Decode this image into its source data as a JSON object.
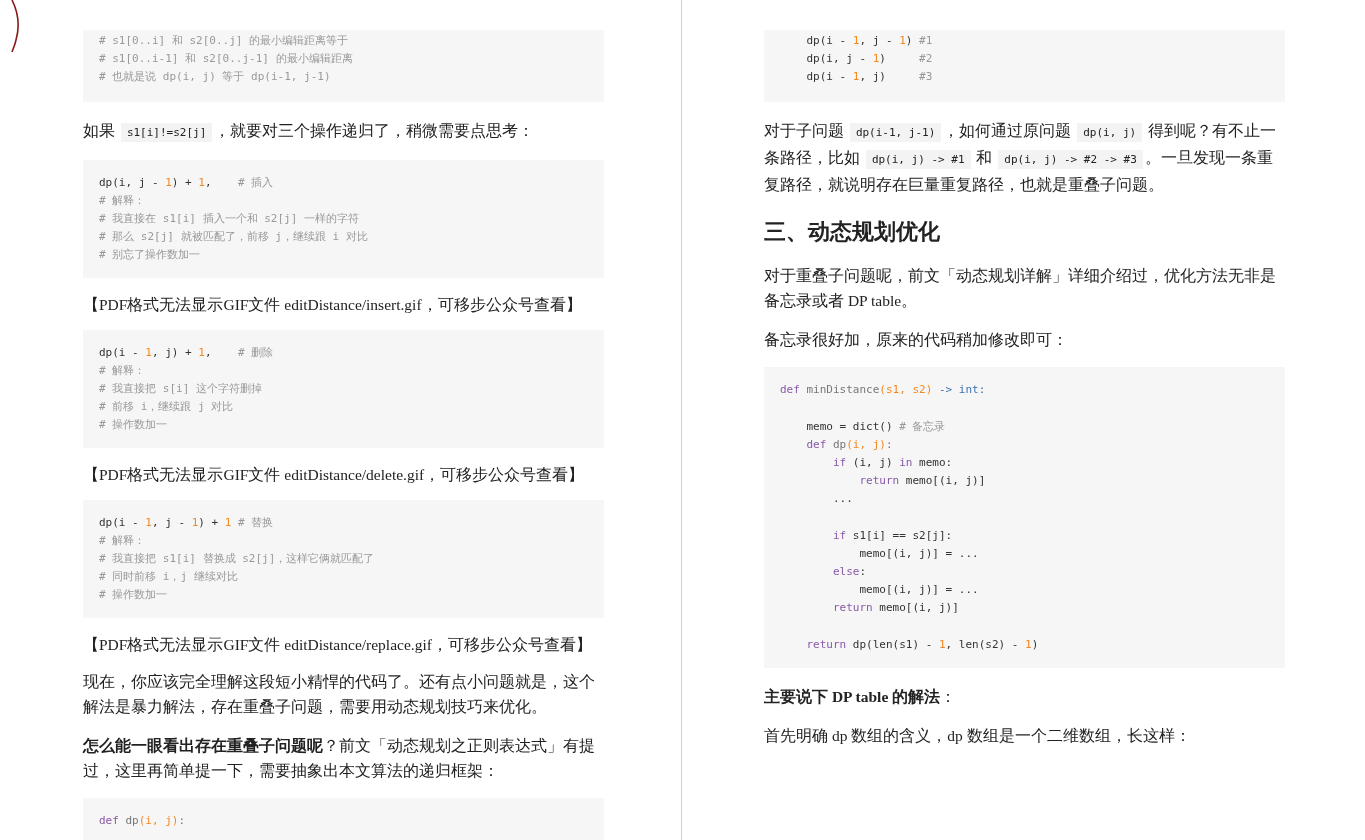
{
  "pages": [
    {
      "blocks": [
        {
          "kind": "code",
          "cut_top": true,
          "lines": [
            {
              "tokens": [
                {
                  "kind": "comment",
                  "text": "# s1[0..i] 和 s2[0..j] 的最小编辑距离等于"
                }
              ]
            },
            {
              "tokens": [
                {
                  "kind": "comment",
                  "text": "# s1[0..i-1] 和 s2[0..j-1] 的最小编辑距离"
                }
              ]
            },
            {
              "tokens": [
                {
                  "kind": "comment",
                  "text": "# 也就是说 dp(i, j) 等于 dp(i-1, j-1)"
                }
              ]
            }
          ]
        },
        {
          "kind": "paragraph",
          "segments": [
            {
              "kind": "text",
              "text": "如果 "
            },
            {
              "kind": "code",
              "text": "s1[i]!=s2[j]"
            },
            {
              "kind": "text",
              "text": "，就要对三个操作递归了，稍微需要点思考："
            }
          ]
        },
        {
          "kind": "code",
          "cut_top": false,
          "lines": [
            {
              "tokens": [
                {
                  "kind": "plain",
                  "text": "dp(i, j - "
                },
                {
                  "kind": "number",
                  "text": "1"
                },
                {
                  "kind": "plain",
                  "text": ") + "
                },
                {
                  "kind": "number",
                  "text": "1"
                },
                {
                  "kind": "plain",
                  "text": ",    "
                },
                {
                  "kind": "comment",
                  "text": "# 插入"
                }
              ]
            },
            {
              "tokens": [
                {
                  "kind": "comment",
                  "text": "# 解释："
                }
              ]
            },
            {
              "tokens": [
                {
                  "kind": "comment",
                  "text": "# 我直接在 s1[i] 插入一个和 s2[j] 一样的字符"
                }
              ]
            },
            {
              "tokens": [
                {
                  "kind": "comment",
                  "text": "# 那么 s2[j] 就被匹配了，前移 j，继续跟 i 对比"
                }
              ]
            },
            {
              "tokens": [
                {
                  "kind": "comment",
                  "text": "# 别忘了操作数加一"
                }
              ]
            }
          ]
        },
        {
          "kind": "notice",
          "text": "【PDF格式无法显示GIF文件 editDistance/insert.gif，可移步公众号查看】"
        },
        {
          "kind": "code",
          "cut_top": false,
          "lines": [
            {
              "tokens": [
                {
                  "kind": "plain",
                  "text": "dp(i - "
                },
                {
                  "kind": "number",
                  "text": "1"
                },
                {
                  "kind": "plain",
                  "text": ", j) + "
                },
                {
                  "kind": "number",
                  "text": "1"
                },
                {
                  "kind": "plain",
                  "text": ",    "
                },
                {
                  "kind": "comment",
                  "text": "# 删除"
                }
              ]
            },
            {
              "tokens": [
                {
                  "kind": "comment",
                  "text": "# 解释："
                }
              ]
            },
            {
              "tokens": [
                {
                  "kind": "comment",
                  "text": "# 我直接把 s[i] 这个字符删掉"
                }
              ]
            },
            {
              "tokens": [
                {
                  "kind": "comment",
                  "text": "# 前移 i，继续跟 j 对比"
                }
              ]
            },
            {
              "tokens": [
                {
                  "kind": "comment",
                  "text": "# 操作数加一"
                }
              ]
            }
          ]
        },
        {
          "kind": "notice",
          "text": "【PDF格式无法显示GIF文件 editDistance/delete.gif，可移步公众号查看】"
        },
        {
          "kind": "code",
          "cut_top": false,
          "lines": [
            {
              "tokens": [
                {
                  "kind": "plain",
                  "text": "dp(i - "
                },
                {
                  "kind": "number",
                  "text": "1"
                },
                {
                  "kind": "plain",
                  "text": ", j - "
                },
                {
                  "kind": "number",
                  "text": "1"
                },
                {
                  "kind": "plain",
                  "text": ") + "
                },
                {
                  "kind": "number",
                  "text": "1"
                },
                {
                  "kind": "comment",
                  "text": " # 替换"
                }
              ]
            },
            {
              "tokens": [
                {
                  "kind": "comment",
                  "text": "# 解释："
                }
              ]
            },
            {
              "tokens": [
                {
                  "kind": "comment",
                  "text": "# 我直接把 s1[i] 替换成 s2[j]，这样它俩就匹配了"
                }
              ]
            },
            {
              "tokens": [
                {
                  "kind": "comment",
                  "text": "# 同时前移 i，j 继续对比"
                }
              ]
            },
            {
              "tokens": [
                {
                  "kind": "comment",
                  "text": "# 操作数加一"
                }
              ]
            }
          ]
        },
        {
          "kind": "notice",
          "text": "【PDF格式无法显示GIF文件 editDistance/replace.gif，可移步公众号查看】"
        },
        {
          "kind": "paragraph",
          "segments": [
            {
              "kind": "text",
              "text": "现在，你应该完全理解这段短小精悍的代码了。还有点小问题就是，这个解法是暴力解法，存在重叠子问题，需要用动态规划技巧来优化。"
            }
          ]
        },
        {
          "kind": "paragraph",
          "segments": [
            {
              "kind": "bold",
              "text": "怎么能一眼看出存在重叠子问题呢"
            },
            {
              "kind": "text",
              "text": "？前文「动态规划之正则表达式」有提过，这里再简单提一下，需要抽象出本文算法的递归框架："
            }
          ]
        },
        {
          "kind": "code",
          "cut_top": false,
          "lines": [
            {
              "tokens": [
                {
                  "kind": "keyword",
                  "text": "def"
                },
                {
                  "kind": "name",
                  "text": " dp"
                },
                {
                  "kind": "param",
                  "text": "(i, j)"
                },
                {
                  "kind": "name",
                  "text": ":"
                }
              ]
            }
          ]
        }
      ]
    },
    {
      "blocks": [
        {
          "kind": "code",
          "cut_top": true,
          "lines": [
            {
              "tokens": [
                {
                  "kind": "plain",
                  "text": "    dp(i - "
                },
                {
                  "kind": "number",
                  "text": "1"
                },
                {
                  "kind": "plain",
                  "text": ", j - "
                },
                {
                  "kind": "number",
                  "text": "1"
                },
                {
                  "kind": "plain",
                  "text": ") "
                },
                {
                  "kind": "comment",
                  "text": "#1"
                }
              ]
            },
            {
              "tokens": [
                {
                  "kind": "plain",
                  "text": "    dp(i, j - "
                },
                {
                  "kind": "number",
                  "text": "1"
                },
                {
                  "kind": "plain",
                  "text": ")     "
                },
                {
                  "kind": "comment",
                  "text": "#2"
                }
              ]
            },
            {
              "tokens": [
                {
                  "kind": "plain",
                  "text": "    dp(i - "
                },
                {
                  "kind": "number",
                  "text": "1"
                },
                {
                  "kind": "plain",
                  "text": ", j)     "
                },
                {
                  "kind": "comment",
                  "text": "#3"
                }
              ]
            }
          ]
        },
        {
          "kind": "paragraph",
          "segments": [
            {
              "kind": "text",
              "text": "对于子问题 "
            },
            {
              "kind": "code",
              "text": "dp(i-1, j-1)"
            },
            {
              "kind": "text",
              "text": "，如何通过原问题 "
            },
            {
              "kind": "code",
              "text": "dp(i, j)"
            },
            {
              "kind": "text",
              "text": " 得到呢？有不止一条路径，比如 "
            },
            {
              "kind": "code",
              "text": "dp(i, j) -> #1"
            },
            {
              "kind": "text",
              "text": " 和 "
            },
            {
              "kind": "code",
              "text": "dp(i, j) -> #2 -> #3"
            },
            {
              "kind": "text",
              "text": "。一旦发现一条重复路径，就说明存在巨量重复路径，也就是重叠子问题。"
            }
          ]
        },
        {
          "kind": "heading",
          "text": "三、动态规划优化"
        },
        {
          "kind": "paragraph",
          "segments": [
            {
              "kind": "text",
              "text": "对于重叠子问题呢，前文「动态规划详解」详细介绍过，优化方法无非是备忘录或者 DP table。"
            }
          ]
        },
        {
          "kind": "paragraph",
          "segments": [
            {
              "kind": "text",
              "text": "备忘录很好加，原来的代码稍加修改即可："
            }
          ]
        },
        {
          "kind": "code",
          "cut_top": false,
          "lines": [
            {
              "tokens": [
                {
                  "kind": "keyword",
                  "text": "def"
                },
                {
                  "kind": "name",
                  "text": " minDistance"
                },
                {
                  "kind": "param",
                  "text": "(s1, s2)"
                },
                {
                  "kind": "type",
                  "text": " -> int:"
                }
              ]
            },
            {
              "blank_before": true,
              "tokens": [
                {
                  "kind": "plain",
                  "text": "    memo = dict() "
                },
                {
                  "kind": "comment",
                  "text": "# 备忘录"
                }
              ]
            },
            {
              "tokens": [
                {
                  "kind": "keyword",
                  "text": "    def"
                },
                {
                  "kind": "name",
                  "text": " dp"
                },
                {
                  "kind": "param",
                  "text": "(i, j)"
                },
                {
                  "kind": "name",
                  "text": ":"
                }
              ]
            },
            {
              "tokens": [
                {
                  "kind": "keyword",
                  "text": "        if"
                },
                {
                  "kind": "plain",
                  "text": " (i, j) "
                },
                {
                  "kind": "keyword",
                  "text": "in"
                },
                {
                  "kind": "plain",
                  "text": " memo:"
                }
              ]
            },
            {
              "tokens": [
                {
                  "kind": "keyword",
                  "text": "            return"
                },
                {
                  "kind": "plain",
                  "text": " memo[(i, j)]"
                }
              ]
            },
            {
              "tokens": [
                {
                  "kind": "plain",
                  "text": "        ..."
                }
              ]
            },
            {
              "blank_before": true,
              "tokens": [
                {
                  "kind": "keyword",
                  "text": "        if"
                },
                {
                  "kind": "plain",
                  "text": " s1[i] == s2[j]:"
                }
              ]
            },
            {
              "tokens": [
                {
                  "kind": "plain",
                  "text": "            memo[(i, j)] = ..."
                }
              ]
            },
            {
              "tokens": [
                {
                  "kind": "keyword",
                  "text": "        else"
                },
                {
                  "kind": "plain",
                  "text": ":"
                }
              ]
            },
            {
              "tokens": [
                {
                  "kind": "plain",
                  "text": "            memo[(i, j)] = ..."
                }
              ]
            },
            {
              "tokens": [
                {
                  "kind": "keyword",
                  "text": "        return"
                },
                {
                  "kind": "plain",
                  "text": " memo[(i, j)]"
                }
              ]
            },
            {
              "blank_before": true,
              "tokens": [
                {
                  "kind": "keyword",
                  "text": "    return"
                },
                {
                  "kind": "plain",
                  "text": " dp(len(s1) - "
                },
                {
                  "kind": "number",
                  "text": "1"
                },
                {
                  "kind": "plain",
                  "text": ", len(s2) - "
                },
                {
                  "kind": "number",
                  "text": "1"
                },
                {
                  "kind": "plain",
                  "text": ")"
                }
              ]
            }
          ]
        },
        {
          "kind": "paragraph",
          "segments": [
            {
              "kind": "bold",
              "text": "主要说下 DP table 的解法"
            },
            {
              "kind": "text",
              "text": "："
            }
          ]
        },
        {
          "kind": "paragraph",
          "segments": [
            {
              "kind": "text",
              "text": "首先明确 dp 数组的含义，dp 数组是一个二维数组，长这样："
            }
          ]
        }
      ]
    }
  ]
}
